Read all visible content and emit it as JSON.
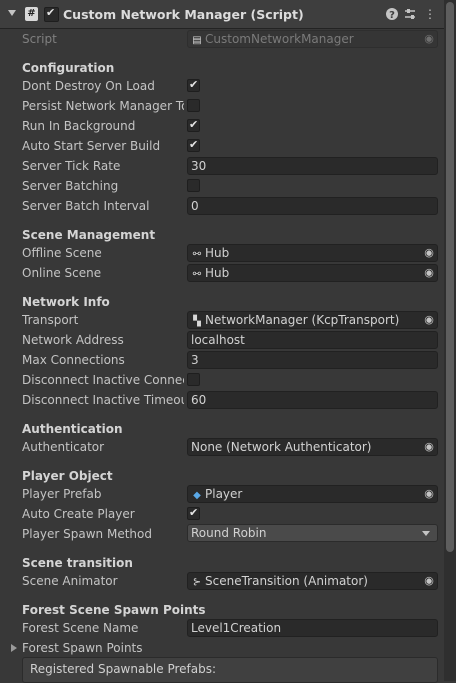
{
  "header": {
    "title": "Custom Network Manager (Script)",
    "script_icon": "#",
    "icons": [
      "help-icon",
      "preset-icon",
      "more-icon"
    ]
  },
  "script": {
    "label": "Script",
    "value": "CustomNetworkManager"
  },
  "configuration": {
    "title": "Configuration",
    "dont_destroy": {
      "label": "Dont Destroy On Load",
      "checked": true
    },
    "persist": {
      "label": "Persist Network Manager To",
      "checked": false
    },
    "run_bg": {
      "label": "Run In Background",
      "checked": true
    },
    "auto_start": {
      "label": "Auto Start Server Build",
      "checked": true
    },
    "tick_rate": {
      "label": "Server Tick Rate",
      "value": "30"
    },
    "batching": {
      "label": "Server Batching",
      "checked": false
    },
    "batch_interval": {
      "label": "Server Batch Interval",
      "value": "0"
    }
  },
  "scene_management": {
    "title": "Scene Management",
    "offline": {
      "label": "Offline Scene",
      "value": "Hub"
    },
    "online": {
      "label": "Online Scene",
      "value": "Hub"
    }
  },
  "network_info": {
    "title": "Network Info",
    "transport": {
      "label": "Transport",
      "value": "NetworkManager (KcpTransport)"
    },
    "address": {
      "label": "Network Address",
      "value": "localhost"
    },
    "max_conn": {
      "label": "Max Connections",
      "value": "3"
    },
    "disconnect_inactive": {
      "label": "Disconnect Inactive Connect",
      "checked": false
    },
    "disconnect_timeout": {
      "label": "Disconnect Inactive Timeout",
      "value": "60"
    }
  },
  "authentication": {
    "title": "Authentication",
    "authenticator": {
      "label": "Authenticator",
      "value": "None (Network Authenticator)"
    }
  },
  "player_object": {
    "title": "Player Object",
    "prefab": {
      "label": "Player Prefab",
      "value": "Player"
    },
    "auto_create": {
      "label": "Auto Create Player",
      "checked": true
    },
    "spawn_method": {
      "label": "Player Spawn Method",
      "value": "Round Robin"
    }
  },
  "scene_transition": {
    "title": "Scene transition",
    "animator": {
      "label": "Scene Animator",
      "value": "SceneTransition (Animator)"
    }
  },
  "forest": {
    "title": "Forest Scene Spawn Points",
    "scene_name": {
      "label": "Forest Scene Name",
      "value": "Level1Creation"
    },
    "spawn_points": {
      "label": "Forest Spawn Points"
    }
  },
  "registered_prefabs": {
    "label": "Registered Spawnable Prefabs:"
  }
}
